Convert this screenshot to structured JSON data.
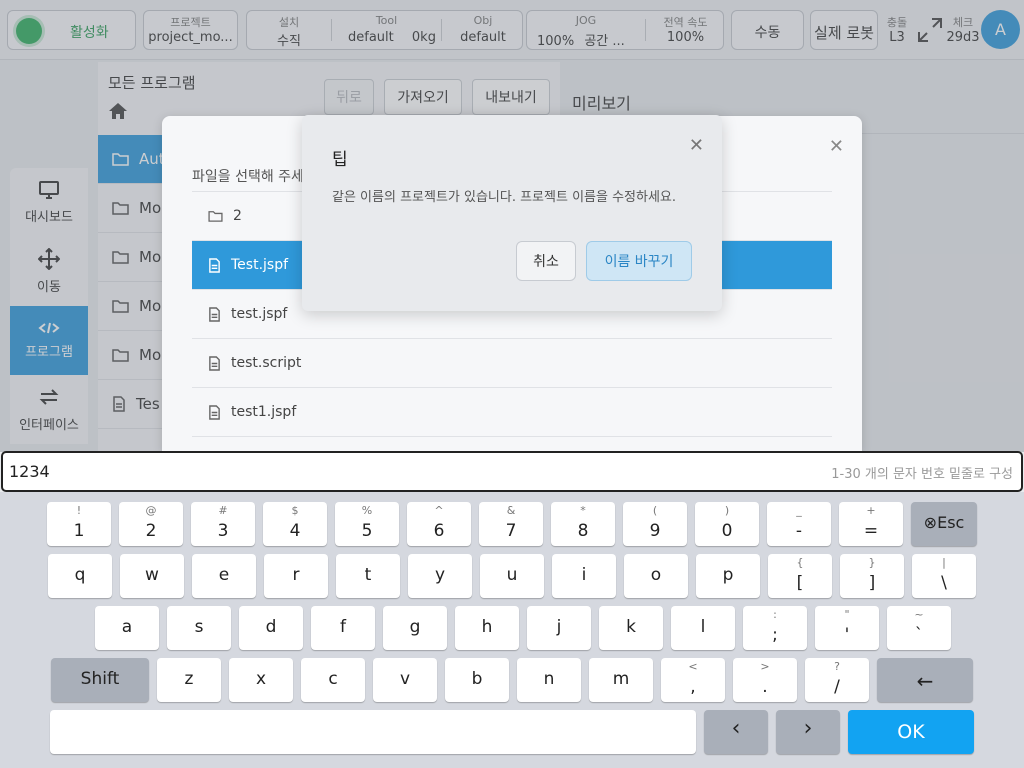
{
  "topbar": {
    "activate_label": "활성화",
    "project_caption": "프로젝트",
    "project_value": "project_mo...",
    "install_caption": "설치",
    "install_value": "수직",
    "tool_caption": "Tool",
    "tool_value": "default",
    "tool_weight": "0kg",
    "obj_caption": "Obj",
    "obj_value": "default",
    "jog_caption": "JOG",
    "jog_value": "100%",
    "jog_space": "공간 ...",
    "speed_caption": "전역 속도",
    "speed_value": "100%",
    "manual_label": "수동",
    "real_robot_label": "실제 로봇",
    "collision_caption": "충돌",
    "collision_value": "L3",
    "check_caption": "체크",
    "check_value": "29d3",
    "avatar_letter": "A",
    "accent_color": "#2f99da",
    "status_color": "#2fae5f"
  },
  "nav": {
    "items": [
      {
        "label": "대시보드",
        "icon": "monitor-icon"
      },
      {
        "label": "이동",
        "icon": "move-arrows-icon"
      },
      {
        "label": "프로그램",
        "icon": "code-icon"
      },
      {
        "label": "인터페이스",
        "icon": "swap-icon"
      }
    ]
  },
  "files": {
    "title": "모든 프로그램",
    "back_label": "뒤로",
    "import_label": "가져오기",
    "export_label": "내보내기",
    "rows": [
      "Aut",
      "Mo",
      "Mo",
      "Mo",
      "Mo",
      "Tes"
    ],
    "preview_title": "미리보기"
  },
  "chooser": {
    "hint": "파일을 선택해 주세요",
    "rows": [
      "2",
      "Test.jspf",
      "test.jspf",
      "test.script",
      "test1.jspf"
    ]
  },
  "tip": {
    "title": "팁",
    "message": "같은 이름의 프로젝트가 있습니다. 프로젝트 이름을 수정하세요.",
    "cancel_label": "취소",
    "rename_label": "이름 바꾸기"
  },
  "keyboard": {
    "input_value": "1234",
    "hint": "1-30 개의 문자 번호 밑줄로 구성",
    "row1": [
      {
        "main": "1",
        "sub": "!"
      },
      {
        "main": "2",
        "sub": "@"
      },
      {
        "main": "3",
        "sub": "#"
      },
      {
        "main": "4",
        "sub": "$"
      },
      {
        "main": "5",
        "sub": "%"
      },
      {
        "main": "6",
        "sub": "^"
      },
      {
        "main": "7",
        "sub": "&"
      },
      {
        "main": "8",
        "sub": "*"
      },
      {
        "main": "9",
        "sub": "("
      },
      {
        "main": "0",
        "sub": ")"
      },
      {
        "main": "-",
        "sub": "_"
      },
      {
        "main": "=",
        "sub": "+"
      }
    ],
    "esc_label": "⊗Esc",
    "row2": [
      {
        "main": "q"
      },
      {
        "main": "w"
      },
      {
        "main": "e"
      },
      {
        "main": "r"
      },
      {
        "main": "t"
      },
      {
        "main": "y"
      },
      {
        "main": "u"
      },
      {
        "main": "i"
      },
      {
        "main": "o"
      },
      {
        "main": "p"
      },
      {
        "main": "[",
        "sub": "{"
      },
      {
        "main": "]",
        "sub": "}"
      },
      {
        "main": "\\",
        "sub": "|"
      }
    ],
    "row3": [
      {
        "main": "a"
      },
      {
        "main": "s"
      },
      {
        "main": "d"
      },
      {
        "main": "f"
      },
      {
        "main": "g"
      },
      {
        "main": "h"
      },
      {
        "main": "j"
      },
      {
        "main": "k"
      },
      {
        "main": "l"
      },
      {
        "main": ";",
        "sub": ":"
      },
      {
        "main": "'",
        "sub": "\""
      },
      {
        "main": "`",
        "sub": "~"
      }
    ],
    "shift_label": "Shift",
    "row4": [
      {
        "main": "z"
      },
      {
        "main": "x"
      },
      {
        "main": "c"
      },
      {
        "main": "v"
      },
      {
        "main": "b"
      },
      {
        "main": "n"
      },
      {
        "main": "m"
      },
      {
        "main": ",",
        "sub": "<"
      },
      {
        "main": ".",
        "sub": ">"
      },
      {
        "main": "/",
        "sub": "?"
      }
    ],
    "backspace_label": "←",
    "left_label": "‹",
    "right_label": "›",
    "ok_label": "OK"
  }
}
